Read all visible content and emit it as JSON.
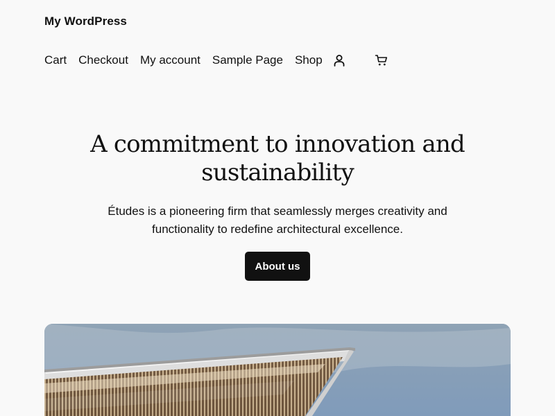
{
  "site": {
    "title": "My WordPress"
  },
  "navigation": {
    "items": [
      {
        "label": "Cart"
      },
      {
        "label": "Checkout"
      },
      {
        "label": "My account"
      },
      {
        "label": "Sample Page"
      },
      {
        "label": "Shop"
      }
    ],
    "icons": {
      "account": "user-icon",
      "cart": "cart-icon"
    }
  },
  "hero": {
    "title": "A commitment to innovation and sustainability",
    "description": "Études is a pioneering firm that seamlessly merges creativity and functionality to redefine architectural excellence.",
    "button_label": "About us"
  },
  "image": {
    "subject": "architectural building facade under blue sky"
  },
  "colors": {
    "background": "#f9f9f9",
    "text": "#111111",
    "button_background": "#111111",
    "button_text": "#ffffff"
  }
}
